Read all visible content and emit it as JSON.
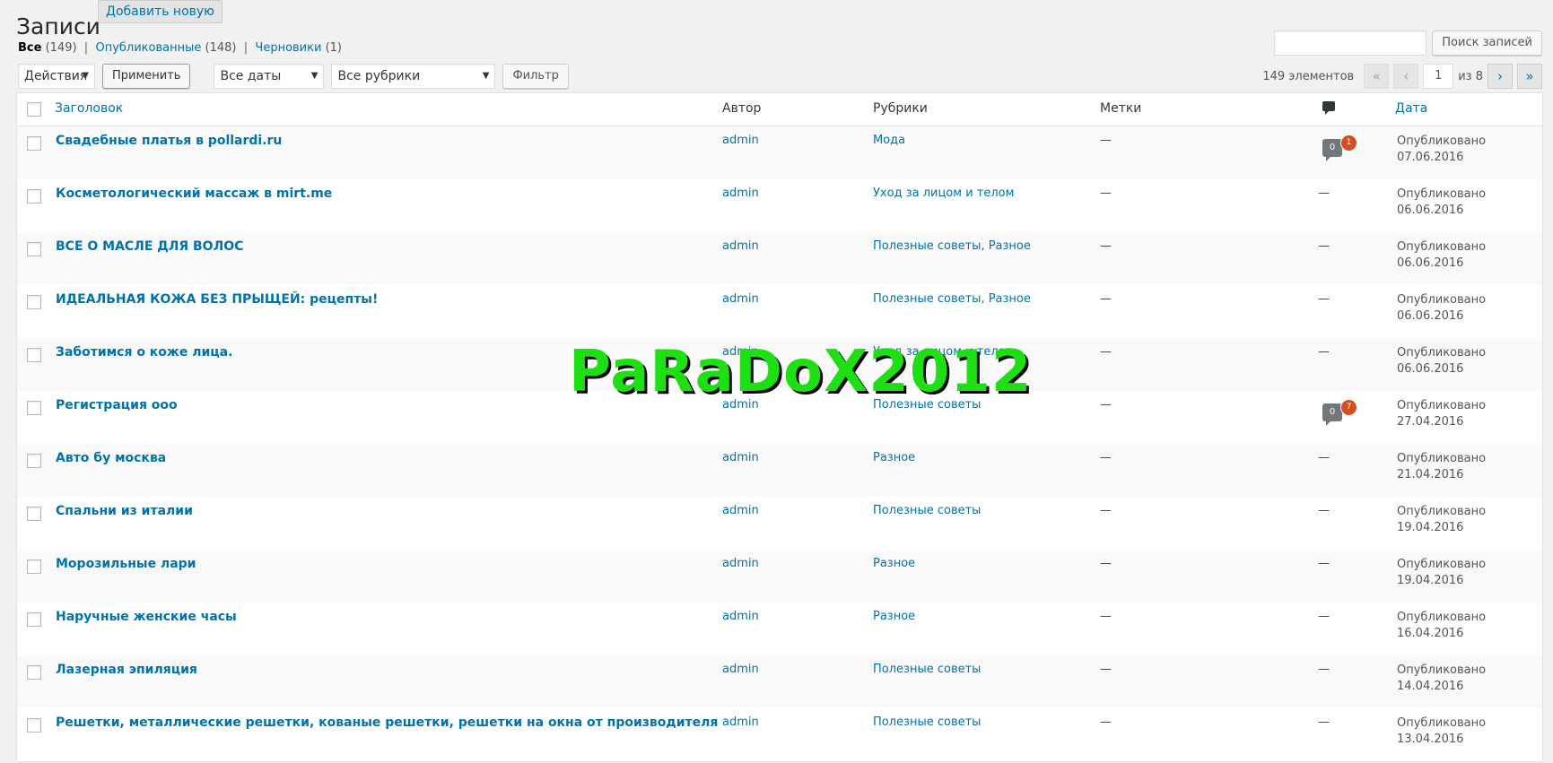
{
  "page": {
    "title": "Записи",
    "add_new_label": "Добавить новую"
  },
  "views": [
    {
      "label": "Все",
      "count": "(149)",
      "current": true
    },
    {
      "label": "Опубликованные",
      "count": "(148)",
      "current": false
    },
    {
      "label": "Черновики",
      "count": "(1)",
      "current": false
    }
  ],
  "search": {
    "button_label": "Поиск записей",
    "value": ""
  },
  "filters": {
    "bulk_action": "Действия",
    "apply_label": "Применить",
    "date": "Все даты",
    "category": "Все рубрики",
    "filter_label": "Фильтр"
  },
  "pagination": {
    "items_label": "149 элементов",
    "first": "«",
    "prev": "‹",
    "current_page": "1",
    "of_label": "из 8",
    "next": "›",
    "last": "»"
  },
  "columns": {
    "title": "Заголовок",
    "author": "Автор",
    "categories": "Рубрики",
    "tags": "Метки",
    "date": "Дата"
  },
  "rows": [
    {
      "title": "Свадебные платья в pollardi.ru",
      "author": "admin",
      "categories": "Мода",
      "tags": "—",
      "comments": "0",
      "pending": "1",
      "status": "Опубликовано",
      "date": "07.06.2016"
    },
    {
      "title": "Косметологический массаж в mirt.me",
      "author": "admin",
      "categories": "Уход за лицом и телом",
      "tags": "—",
      "comments": "—",
      "status": "Опубликовано",
      "date": "06.06.2016"
    },
    {
      "title": "ВСЕ О МАСЛЕ ДЛЯ ВОЛОС",
      "author": "admin",
      "categories": "Полезные советы, Разное",
      "tags": "—",
      "comments": "—",
      "status": "Опубликовано",
      "date": "06.06.2016"
    },
    {
      "title": "ИДЕАЛЬНАЯ КОЖА БЕЗ ПРЫЩЕЙ: рецепты!",
      "author": "admin",
      "categories": "Полезные советы, Разное",
      "tags": "—",
      "comments": "—",
      "status": "Опубликовано",
      "date": "06.06.2016"
    },
    {
      "title": "Заботимся о коже лица.",
      "author": "admin",
      "categories": "Уход за лицом и телом",
      "tags": "—",
      "comments": "—",
      "status": "Опубликовано",
      "date": "06.06.2016"
    },
    {
      "title": "Регистрация ооо",
      "author": "admin",
      "categories": "Полезные советы",
      "tags": "—",
      "comments": "0",
      "pending": "7",
      "status": "Опубликовано",
      "date": "27.04.2016"
    },
    {
      "title": "Авто бу москва",
      "author": "admin",
      "categories": "Разное",
      "tags": "—",
      "comments": "—",
      "status": "Опубликовано",
      "date": "21.04.2016"
    },
    {
      "title": "Спальни из италии",
      "author": "admin",
      "categories": "Полезные советы",
      "tags": "—",
      "comments": "—",
      "status": "Опубликовано",
      "date": "19.04.2016"
    },
    {
      "title": "Морозильные лари",
      "author": "admin",
      "categories": "Разное",
      "tags": "—",
      "comments": "—",
      "status": "Опубликовано",
      "date": "19.04.2016"
    },
    {
      "title": "Наручные женские часы",
      "author": "admin",
      "categories": "Разное",
      "tags": "—",
      "comments": "—",
      "status": "Опубликовано",
      "date": "16.04.2016"
    },
    {
      "title": "Лазерная эпиляция",
      "author": "admin",
      "categories": "Полезные советы",
      "tags": "—",
      "comments": "—",
      "status": "Опубликовано",
      "date": "14.04.2016"
    },
    {
      "title": "Решетки, металлические решетки, кованые решетки, решетки на окна от производителя",
      "author": "admin",
      "categories": "Полезные советы",
      "tags": "—",
      "comments": "—",
      "status": "Опубликовано",
      "date": "13.04.2016"
    }
  ],
  "watermark": "PaRaDoX2012",
  "colors": {
    "link": "#0073aa",
    "pending_badge": "#d54e21",
    "watermark": "#1ede14"
  }
}
